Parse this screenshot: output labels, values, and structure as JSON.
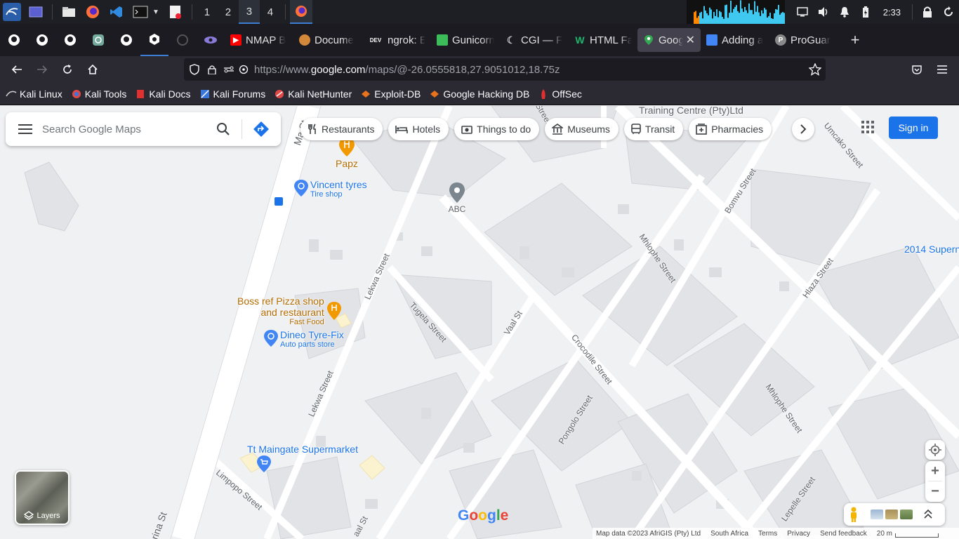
{
  "taskbar": {
    "workspaces": [
      "1",
      "2",
      "3",
      "4"
    ],
    "active_workspace": "3",
    "clock": "2:33",
    "app_icons": [
      "kali-menu-icon",
      "desktop-icon",
      "file-manager-icon",
      "firefox-icon",
      "vscode-icon",
      "terminal-icon",
      "dropdown-icon",
      "text-editor-icon"
    ]
  },
  "tabs": {
    "pinned": [
      "github-icon",
      "github-icon",
      "github-icon",
      "chatgpt-icon",
      "github-icon",
      "burp-icon",
      "gear-icon",
      "eye-icon"
    ],
    "items": [
      {
        "title": "NMAP B",
        "fav": "youtube",
        "color": "#ff0000"
      },
      {
        "title": "Docume",
        "fav": "cookie",
        "color": "#d4893a"
      },
      {
        "title": "ngrok: E",
        "fav": "DEV",
        "color": "#ffffff"
      },
      {
        "title": "Gunicorn",
        "fav": "chart",
        "color": "#3dbc5a"
      },
      {
        "title": "CGI — F",
        "fav": "moon",
        "color": "#bbbbbb"
      },
      {
        "title": "HTML Fa",
        "fav": "W",
        "color": "#1fb56c"
      },
      {
        "title": "Googl",
        "fav": "maps",
        "color": "#34a853",
        "active": true
      },
      {
        "title": "Adding a",
        "fav": "logo",
        "color": "#4285f4"
      },
      {
        "title": "ProGuar",
        "fav": "P",
        "color": "#888888"
      }
    ]
  },
  "navbar": {
    "url_prefix": "https://www.",
    "url_domain": "google.com",
    "url_path": "/maps/@-26.0555818,27.9051012,18.75z"
  },
  "bookmarks": [
    {
      "label": "Kali Linux",
      "color": "#cccccc"
    },
    {
      "label": "Kali Tools",
      "color": "#e04848"
    },
    {
      "label": "Kali Docs",
      "color": "#e03030"
    },
    {
      "label": "Kali Forums",
      "color": "#3a77d8"
    },
    {
      "label": "Kali NetHunter",
      "color": "#e04848"
    },
    {
      "label": "Exploit-DB",
      "color": "#e8731c"
    },
    {
      "label": "Google Hacking DB",
      "color": "#e8731c"
    },
    {
      "label": "OffSec",
      "color": "#e03030"
    }
  ],
  "maps": {
    "search_placeholder": "Search Google Maps",
    "chips": [
      "Restaurants",
      "Hotels",
      "Things to do",
      "Museums",
      "Transit",
      "Pharmacies"
    ],
    "sign_in": "Sign in",
    "layers": "Layers",
    "google": "Google",
    "footer": {
      "map_data": "Map data ©2023 AfriGIS (Pty) Ltd",
      "country": "South Africa",
      "terms": "Terms",
      "privacy": "Privacy",
      "feedback": "Send feedback",
      "scale": "20 m"
    },
    "pois": {
      "papz": "Papz",
      "vincent": "Vincent tyres",
      "vincent_sub": "Tire shop",
      "abc": "ABC",
      "boss_1": "Boss ref Pizza shop",
      "boss_2": "and restaurant",
      "boss_sub": "Fast Food",
      "dineo": "Dineo Tyre-Fix",
      "dineo_sub": "Auto parts store",
      "tt": "Tt Maingate Supermarket",
      "training": "Training Centre (Pty)Ltd",
      "super2014": "2014 Supern"
    },
    "streets": {
      "lekwa1": "Lekwa Street",
      "lekwa2": "Lekwa Street",
      "tugela": "Tugela Street",
      "vaal": "Vaal St",
      "crocodile": "Crocodile Street",
      "pongolo": "Pongolo Street",
      "mhlophe1": "Mhlophe Street",
      "mhlophe2": "Mhlophe Street",
      "bomvu": "Bomvu Street",
      "umcako": "Umcako Street",
      "hlaza": "Hlaza Street",
      "lepelle": "Lepelle Street",
      "limpopo": "Limpopo Street",
      "marina": "rina St",
      "ma": "Ma St",
      "street_top": "Street",
      "vaal_bottom": "aal St"
    }
  }
}
